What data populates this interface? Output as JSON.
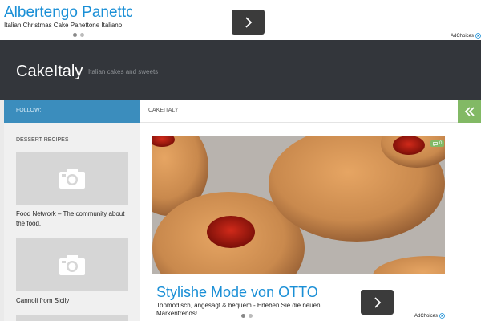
{
  "top_ad": {
    "title": "Albertengo Panettone",
    "subtitle": "Italian Christmas Cake Panettone Italiano",
    "adchoices": "AdChoices"
  },
  "header": {
    "site_title": "CakeItaly",
    "site_description": "Italian cakes and sweets"
  },
  "sidebar": {
    "follow_label": "FOLLOW:",
    "section_heading": "DESSERT RECIPES",
    "items": [
      {
        "label": "Food Network – The community about the food."
      },
      {
        "label": "Cannoli from Sicily"
      }
    ]
  },
  "main": {
    "breadcrumb": "CAKEITALY",
    "comment_count": "0"
  },
  "bottom_ad": {
    "title": "Stylishe Mode von OTTO",
    "subtitle": "Topmodisch, angesagt & bequem - Erleben Sie die neuen Markentrends!",
    "adchoices": "AdChoices"
  },
  "colors": {
    "header_bg": "#33363b",
    "follow_bar": "#3b8dbd",
    "accent_green": "#82b965",
    "ad_link_blue": "#1a8fd6"
  },
  "icons": [
    "chevron-right-icon",
    "camera-icon",
    "double-chevron-left-icon",
    "comment-icon",
    "adchoices-icon"
  ]
}
